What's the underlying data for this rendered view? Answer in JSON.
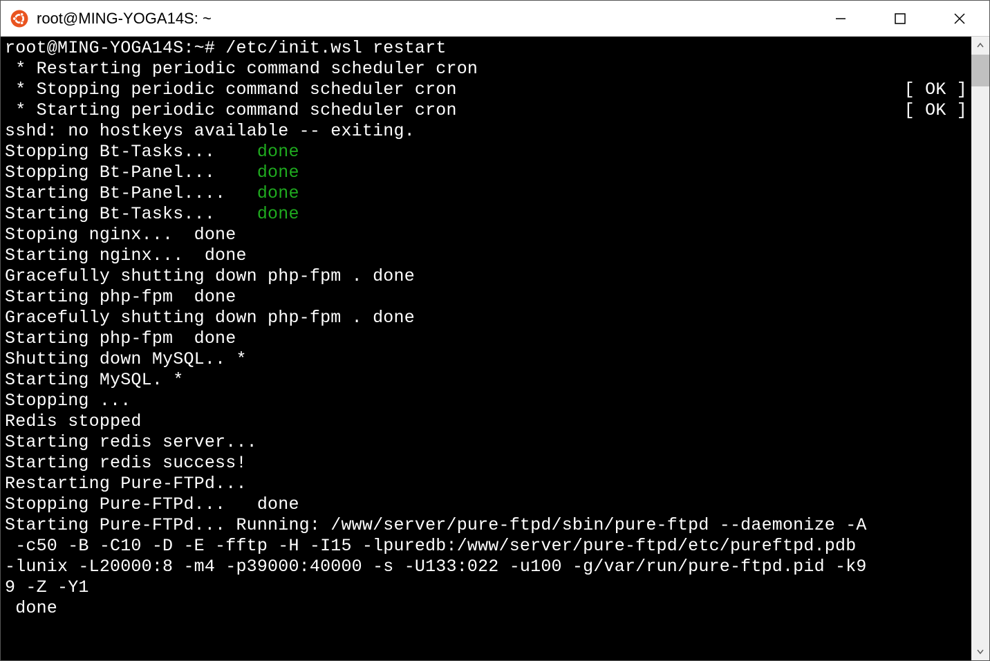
{
  "window": {
    "title": "root@MING-YOGA14S: ~"
  },
  "terminal": {
    "prompt": "root@MING-YOGA14S:~# ",
    "command": "/etc/init.wsl restart",
    "lines": {
      "l1": " * Restarting periodic command scheduler cron",
      "l2_left": " * Stopping periodic command scheduler cron",
      "l2_right": "[ OK ]",
      "l3_left": " * Starting periodic command scheduler cron",
      "l3_right": "[ OK ]",
      "l4": "sshd: no hostkeys available -- exiting.",
      "l5a": "Stopping Bt-Tasks...    ",
      "l5b": "done",
      "l6a": "Stopping Bt-Panel...    ",
      "l6b": "done",
      "l7a": "Starting Bt-Panel....   ",
      "l7b": "done",
      "l8a": "Starting Bt-Tasks...    ",
      "l8b": "done",
      "l9": "Stoping nginx...  done",
      "l10": "Starting nginx...  done",
      "l11": "Gracefully shutting down php-fpm . done",
      "l12": "Starting php-fpm  done",
      "l13": "Gracefully shutting down php-fpm . done",
      "l14": "Starting php-fpm  done",
      "l15": "Shutting down MySQL.. *",
      "l16": "Starting MySQL. *",
      "l17": "Stopping ...",
      "l18": "Redis stopped",
      "l19": "Starting redis server...",
      "l20": "Starting redis success!",
      "l21": "Restarting Pure-FTPd...",
      "l22": "Stopping Pure-FTPd...   done",
      "l23": "Starting Pure-FTPd... Running: /www/server/pure-ftpd/sbin/pure-ftpd --daemonize -A",
      "l24": " -c50 -B -C10 -D -E -fftp -H -I15 -lpuredb:/www/server/pure-ftpd/etc/pureftpd.pdb ",
      "l25": "-lunix -L20000:8 -m4 -p39000:40000 -s -U133:022 -u100 -g/var/run/pure-ftpd.pid -k9",
      "l26": "9 -Z -Y1",
      "l27": " done"
    }
  }
}
